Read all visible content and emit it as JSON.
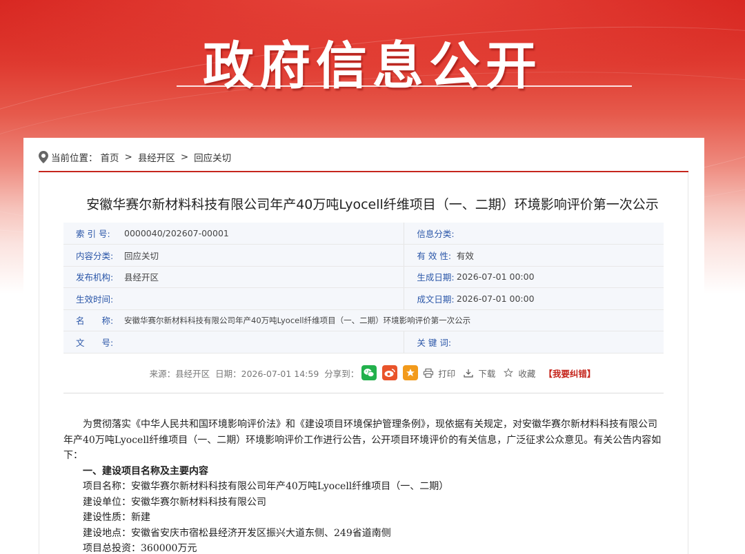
{
  "banner": {
    "title": "政府信息公开"
  },
  "breadcrumb": {
    "prefix": "当前位置：",
    "items": [
      "首页",
      "县经开区",
      "回应关切"
    ],
    "separator": ">"
  },
  "article": {
    "title": "安徽华赛尔新材料科技有限公司年产40万吨Lyocell纤维项目（一、二期）环境影响评价第一次公示"
  },
  "meta": {
    "index_label": "索 引 号:",
    "index_value": "0000040/202607-00001",
    "info_cat_label": "信息分类:",
    "info_cat_value": "",
    "content_cat_label": "内容分类:",
    "content_cat_value": "回应关切",
    "validity_label": "有 效 性:",
    "validity_value": "有效",
    "publisher_label": "发布机构:",
    "publisher_value": "县经开区",
    "gen_date_label": "生成日期:",
    "gen_date_value": "2026-07-01 00:00",
    "effective_label": "生效时间:",
    "effective_value": "",
    "written_date_label": "成文日期:",
    "written_date_value": "2026-07-01 00:00",
    "name_label": "名　　称:",
    "name_value": "安徽华赛尔新材料科技有限公司年产40万吨Lyocell纤维项目（一、二期）环境影响评价第一次公示",
    "doc_no_label": "文　　号:",
    "doc_no_value": "",
    "keywords_label": "关 键 词:",
    "keywords_value": ""
  },
  "infobar": {
    "source": "来源：县经开区",
    "date": "日期：2026-07-01 14:59",
    "share_label": "分享到：",
    "print": "打印",
    "download": "下载",
    "favorite": "收藏",
    "report": "【我要纠错】"
  },
  "content": {
    "intro": "为贯彻落实《中华人民共和国环境影响评价法》和《建设项目环境保护管理条例》，现依据有关规定，对安徽华赛尔新材料科技有限公司年产40万吨Lyocell纤维项目（一、二期）环境影响评价工作进行公告，公开项目环境评价的有关信息，广泛征求公众意见。有关公告内容如下：",
    "section1": "一、建设项目名称及主要内容",
    "item_name": "项目名称：安徽华赛尔新材料科技有限公司年产40万吨Lyocell纤维项目（一、二期）",
    "item_unit": "建设单位：安徽华赛尔新材料科技有限公司",
    "item_nature": "建设性质：新建",
    "item_location": "建设地点：安徽省安庆市宿松县经济开发区振兴大道东侧、249省道南侧",
    "item_invest": "项目总投资：360000万元"
  },
  "colors": {
    "accent": "#c5251c",
    "label_blue": "#2a56a8"
  }
}
